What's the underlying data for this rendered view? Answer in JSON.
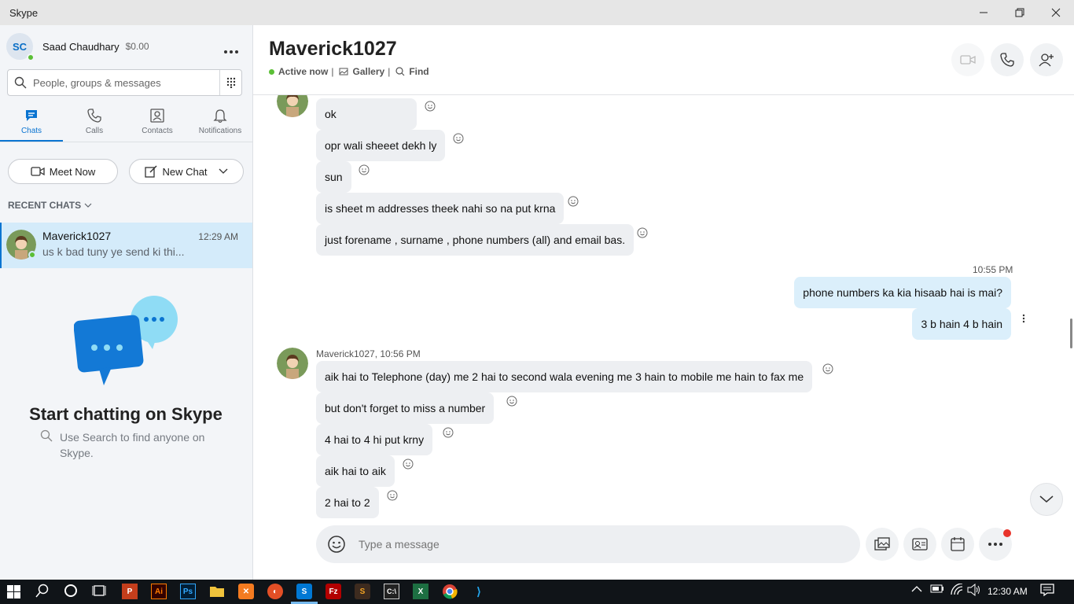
{
  "window": {
    "title": "Skype"
  },
  "profile": {
    "initials": "SC",
    "name": "Saad Chaudhary",
    "balance": "$0.00"
  },
  "search": {
    "placeholder": "People, groups & messages"
  },
  "nav": {
    "chats": "Chats",
    "calls": "Calls",
    "contacts": "Contacts",
    "notifications": "Notifications"
  },
  "actions": {
    "meet_now": "Meet Now",
    "new_chat": "New Chat"
  },
  "recent": {
    "label": "RECENT CHATS",
    "items": [
      {
        "name": "Maverick1027",
        "time": "12:29 AM",
        "preview": "us k bad tuny ye send ki thi..."
      }
    ]
  },
  "empty_state": {
    "title": "Start chatting on Skype",
    "subtitle": "Use Search to find anyone on Skype."
  },
  "conversation": {
    "name": "Maverick1027",
    "status": "Active now",
    "gallery": "Gallery",
    "find": "Find"
  },
  "messages": {
    "group1": [
      "ok",
      "opr wali sheeet dekh ly",
      "sun",
      "is sheet m addresses theek nahi so na put krna",
      "just forename , surname , phone numbers (all) and email bas."
    ],
    "me_time": "10:55 PM",
    "mine": [
      "phone numbers ka kia hisaab hai is mai?",
      "3 b hain 4 b hain"
    ],
    "group2_sender": "Maverick1027, 10:56 PM",
    "group2": [
      "aik hai to Telephone (day) me 2 hai to second wala evening me 3 hain to mobile me  hain to fax me",
      "but don't forget to miss a number",
      "4 hai to 4 hi put krny",
      "aik hai to aik",
      "2 hai to 2"
    ]
  },
  "composer": {
    "placeholder": "Type a message"
  },
  "taskbar": {
    "time": "12:30 AM"
  },
  "colors": {
    "accent": "#0a74d1",
    "online": "#5bbf36",
    "bubble_other": "#edeff2",
    "bubble_me": "#dbeffb"
  }
}
